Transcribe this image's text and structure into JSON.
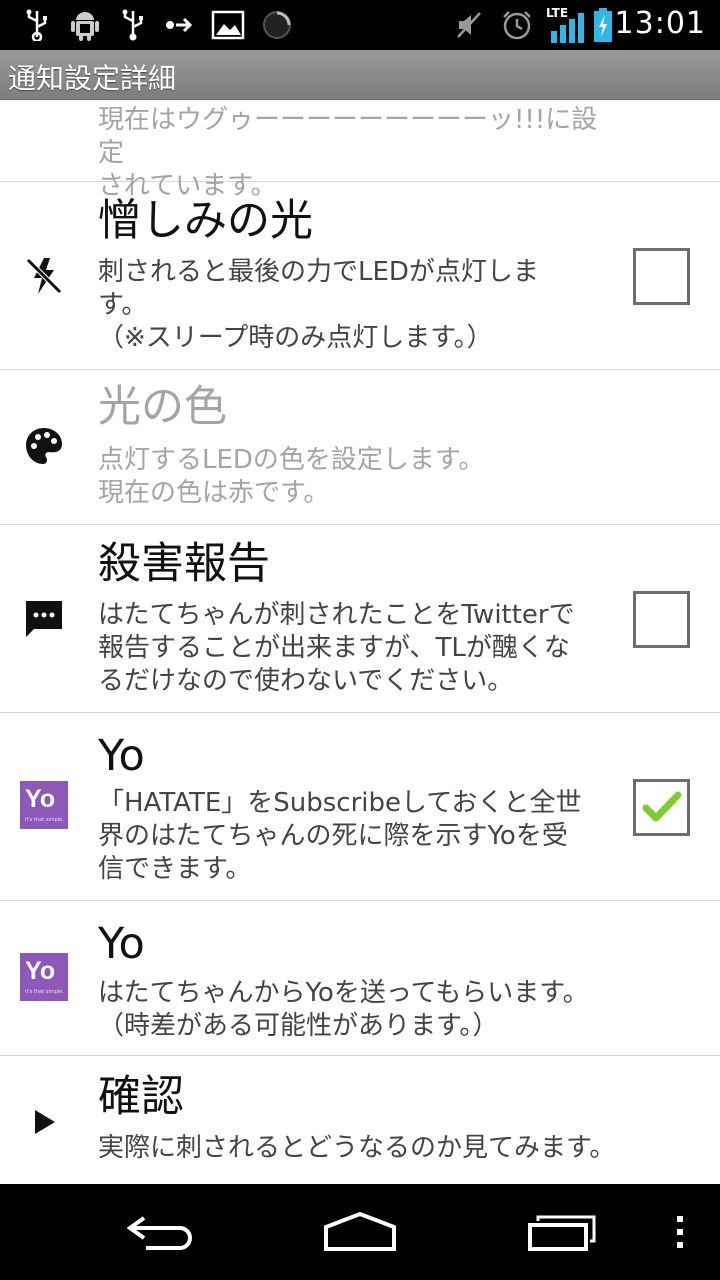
{
  "status_bar": {
    "time": "13:01",
    "network": "LTE",
    "icons": [
      "usb-icon",
      "android-debug-icon",
      "usb-icon",
      "data-transfer-icon",
      "image-icon",
      "loading-icon",
      "mute-icon",
      "alarm-icon",
      "signal-icon",
      "battery-charging-icon"
    ]
  },
  "action_bar": {
    "title": "通知設定詳細"
  },
  "items": [
    {
      "title": "",
      "summary": "現在はウグゥーーーーーーーーーッ!!!に設定\nされています。",
      "icon": "none",
      "checkbox": null,
      "enabled": false
    },
    {
      "title": "憎しみの光",
      "summary": "刺されると最後の力でLEDが点灯しま\nす。\n（※スリープ時のみ点灯します。）",
      "icon": "flash-off-icon",
      "checkbox": false,
      "enabled": true
    },
    {
      "title": "光の色",
      "summary": "点灯するLEDの色を設定します。\n現在の色は赤です。",
      "icon": "palette-icon",
      "checkbox": null,
      "enabled": false
    },
    {
      "title": "殺害報告",
      "summary": "はたてちゃんが刺されたことをTwitterで\n報告することが出来ますが、TLが醜くな\nるだけなので使わないでください。",
      "icon": "chat-bubble-icon",
      "checkbox": false,
      "enabled": true
    },
    {
      "title": "Yo",
      "summary": "「HATATE」をSubscribeしておくと全世\n界のはたてちゃんの死に際を示すYoを受\n信できます。",
      "icon": "yo-app-icon",
      "checkbox": true,
      "enabled": true
    },
    {
      "title": "Yo",
      "summary": "はたてちゃんからYoを送ってもらいます。\n（時差がある可能性があります。）",
      "icon": "yo-app-icon",
      "checkbox": null,
      "enabled": true
    },
    {
      "title": "確認",
      "summary": "実際に刺されるとどうなるのか見てみます。",
      "icon": "play-icon",
      "checkbox": null,
      "enabled": true
    }
  ],
  "yo_icon": {
    "label": "Yo",
    "tagline": "It's that simple."
  },
  "colors": {
    "action_bar": "#8a8a8a",
    "yo_purple": "#8d58b8",
    "check_green": "#7ccd2e",
    "disabled_text": "#a4a4a4"
  },
  "nav_bar": {
    "buttons": [
      "back-icon",
      "home-icon",
      "recent-apps-icon",
      "overflow-menu-icon"
    ]
  }
}
